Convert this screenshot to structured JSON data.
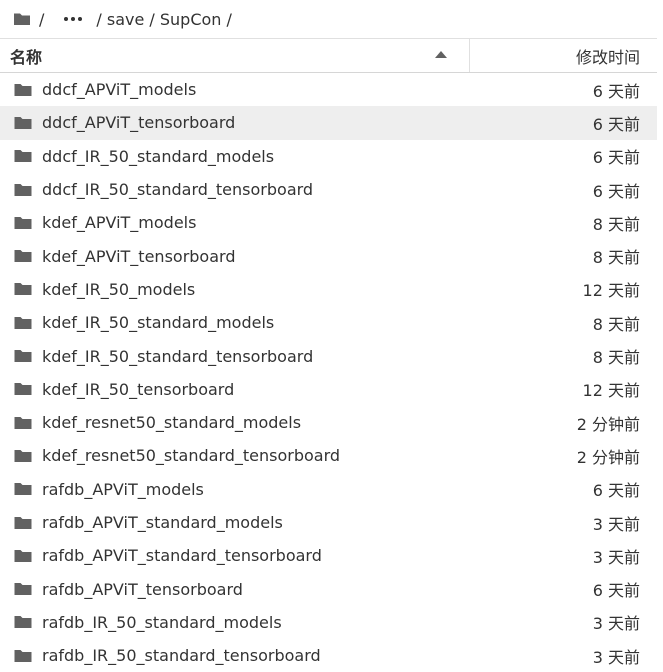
{
  "breadcrumb": {
    "items": [
      "/",
      "/ save / SupCon /"
    ]
  },
  "header": {
    "name_label": "名称",
    "time_label": "修改时间"
  },
  "rows": [
    {
      "name": "ddcf_APViT_models",
      "time": "6 天前"
    },
    {
      "name": "ddcf_APViT_tensorboard",
      "time": "6 天前",
      "selected": true
    },
    {
      "name": "ddcf_IR_50_standard_models",
      "time": "6 天前"
    },
    {
      "name": "ddcf_IR_50_standard_tensorboard",
      "time": "6 天前"
    },
    {
      "name": "kdef_APViT_models",
      "time": "8 天前"
    },
    {
      "name": "kdef_APViT_tensorboard",
      "time": "8 天前"
    },
    {
      "name": "kdef_IR_50_models",
      "time": "12 天前"
    },
    {
      "name": "kdef_IR_50_standard_models",
      "time": "8 天前"
    },
    {
      "name": "kdef_IR_50_standard_tensorboard",
      "time": "8 天前"
    },
    {
      "name": "kdef_IR_50_tensorboard",
      "time": "12 天前"
    },
    {
      "name": "kdef_resnet50_standard_models",
      "time": "2 分钟前"
    },
    {
      "name": "kdef_resnet50_standard_tensorboard",
      "time": "2 分钟前"
    },
    {
      "name": "rafdb_APViT_models",
      "time": "6 天前"
    },
    {
      "name": "rafdb_APViT_standard_models",
      "time": "3 天前"
    },
    {
      "name": "rafdb_APViT_standard_tensorboard",
      "time": "3 天前"
    },
    {
      "name": "rafdb_APViT_tensorboard",
      "time": "6 天前"
    },
    {
      "name": "rafdb_IR_50_standard_models",
      "time": "3 天前"
    },
    {
      "name": "rafdb_IR_50_standard_tensorboard",
      "time": "3 天前"
    }
  ]
}
